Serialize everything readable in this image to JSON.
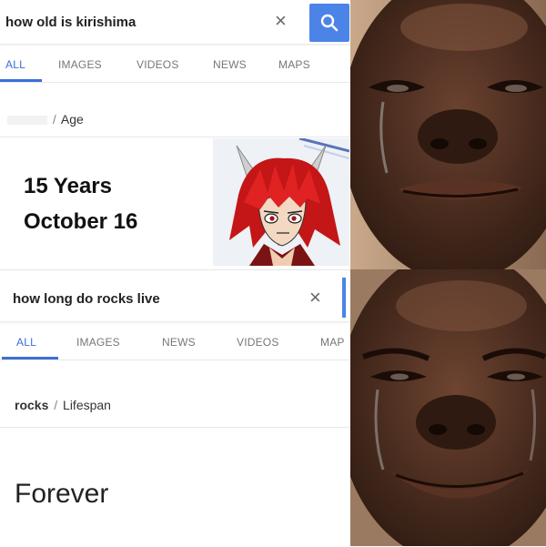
{
  "top_search": {
    "query": "how old is kirishima",
    "clear_icon": "close-icon",
    "search_icon": "search-icon",
    "tabs": [
      "ALL",
      "IMAGES",
      "VIDEOS",
      "NEWS",
      "MAPS"
    ],
    "active_tab": "ALL",
    "breadcrumb_separator": "/",
    "breadcrumb_attribute": "Age",
    "answer_line1": "15 Years",
    "answer_line2": "October 16"
  },
  "bottom_search": {
    "query": "how long do rocks live",
    "clear_icon": "close-icon",
    "tabs": [
      "ALL",
      "IMAGES",
      "NEWS",
      "VIDEOS",
      "MAP"
    ],
    "active_tab": "ALL",
    "breadcrumb_subject": "rocks",
    "breadcrumb_separator": "/",
    "breadcrumb_attribute": "Lifespan",
    "answer": "Forever"
  },
  "colors": {
    "accent_blue": "#3b6fd8",
    "search_button": "#4b84e6",
    "skin": "#3d2418",
    "hair_red": "#d61f1f"
  }
}
